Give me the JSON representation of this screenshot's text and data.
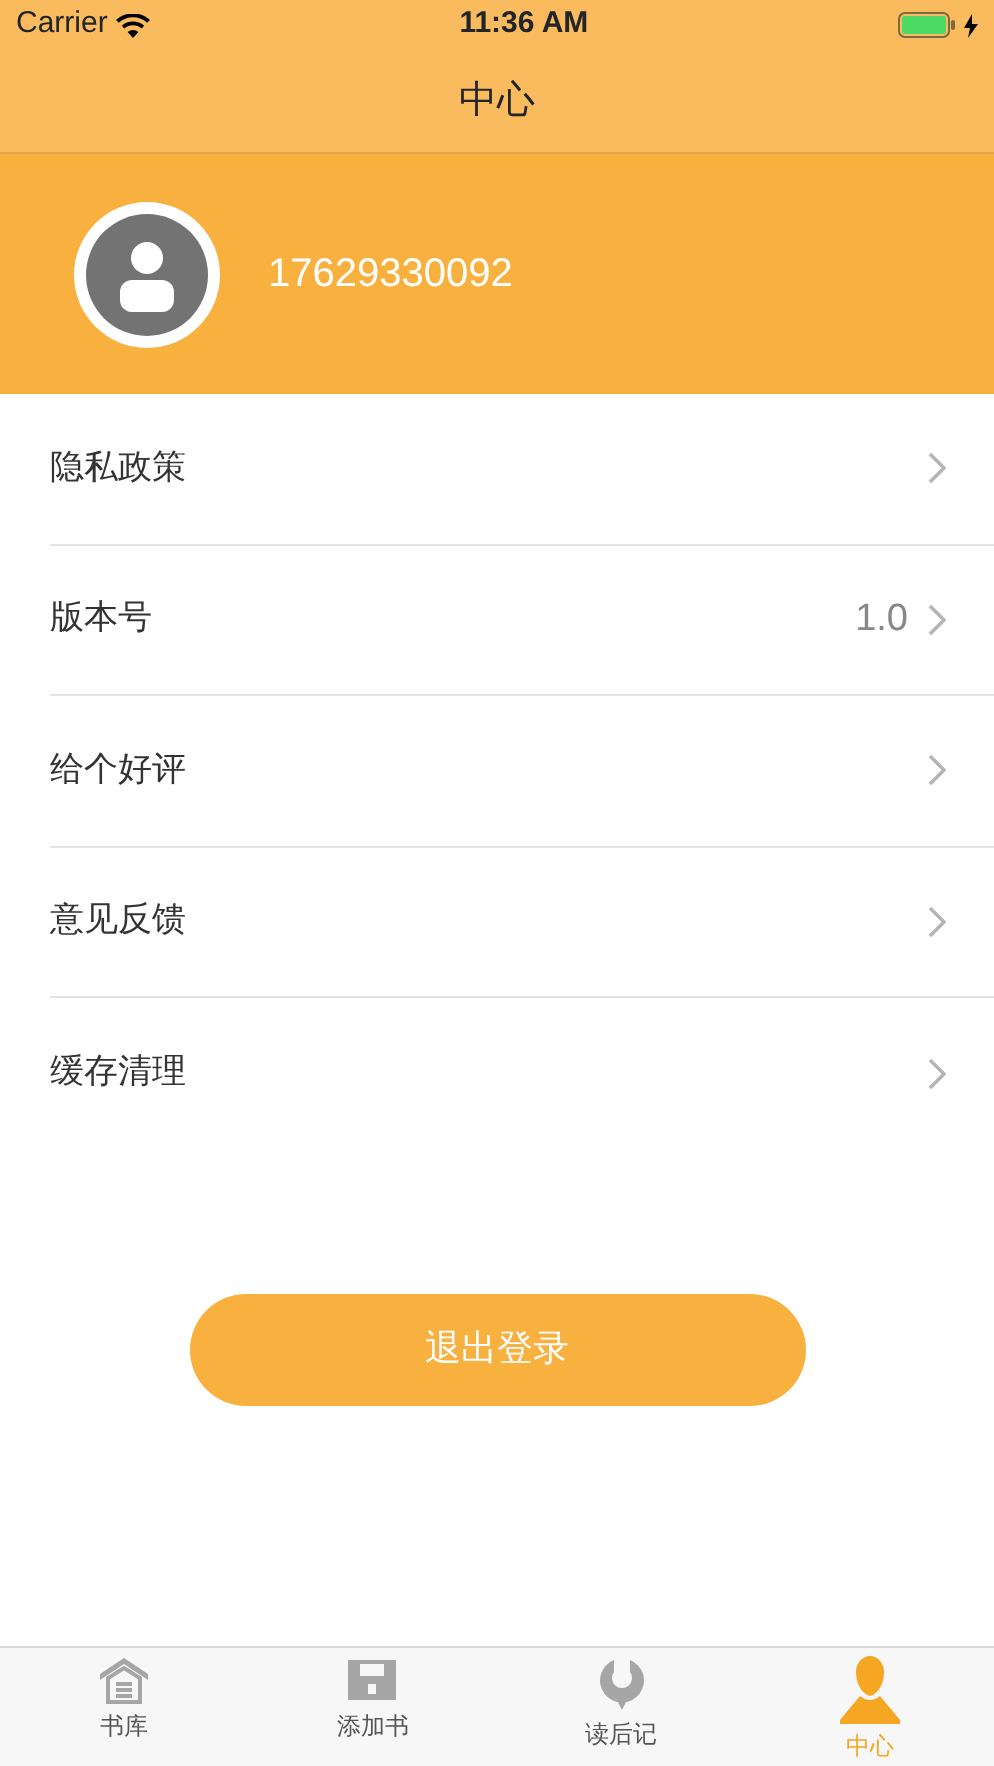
{
  "status_bar": {
    "carrier": "Carrier",
    "time": "11:36 AM"
  },
  "nav_bar": {
    "title": "中心"
  },
  "profile": {
    "phone": "17629330092"
  },
  "menu": [
    {
      "label": "隐私政策"
    },
    {
      "label": "版本号",
      "value": "1.0"
    },
    {
      "label": "给个好评"
    },
    {
      "label": "意见反馈"
    },
    {
      "label": "缓存清理"
    }
  ],
  "logout_button": "退出登录",
  "tab_bar": [
    {
      "label": "书库",
      "selected": false
    },
    {
      "label": "添加书",
      "selected": false
    },
    {
      "label": "读后记",
      "selected": false
    },
    {
      "label": "中心",
      "selected": true
    }
  ]
}
